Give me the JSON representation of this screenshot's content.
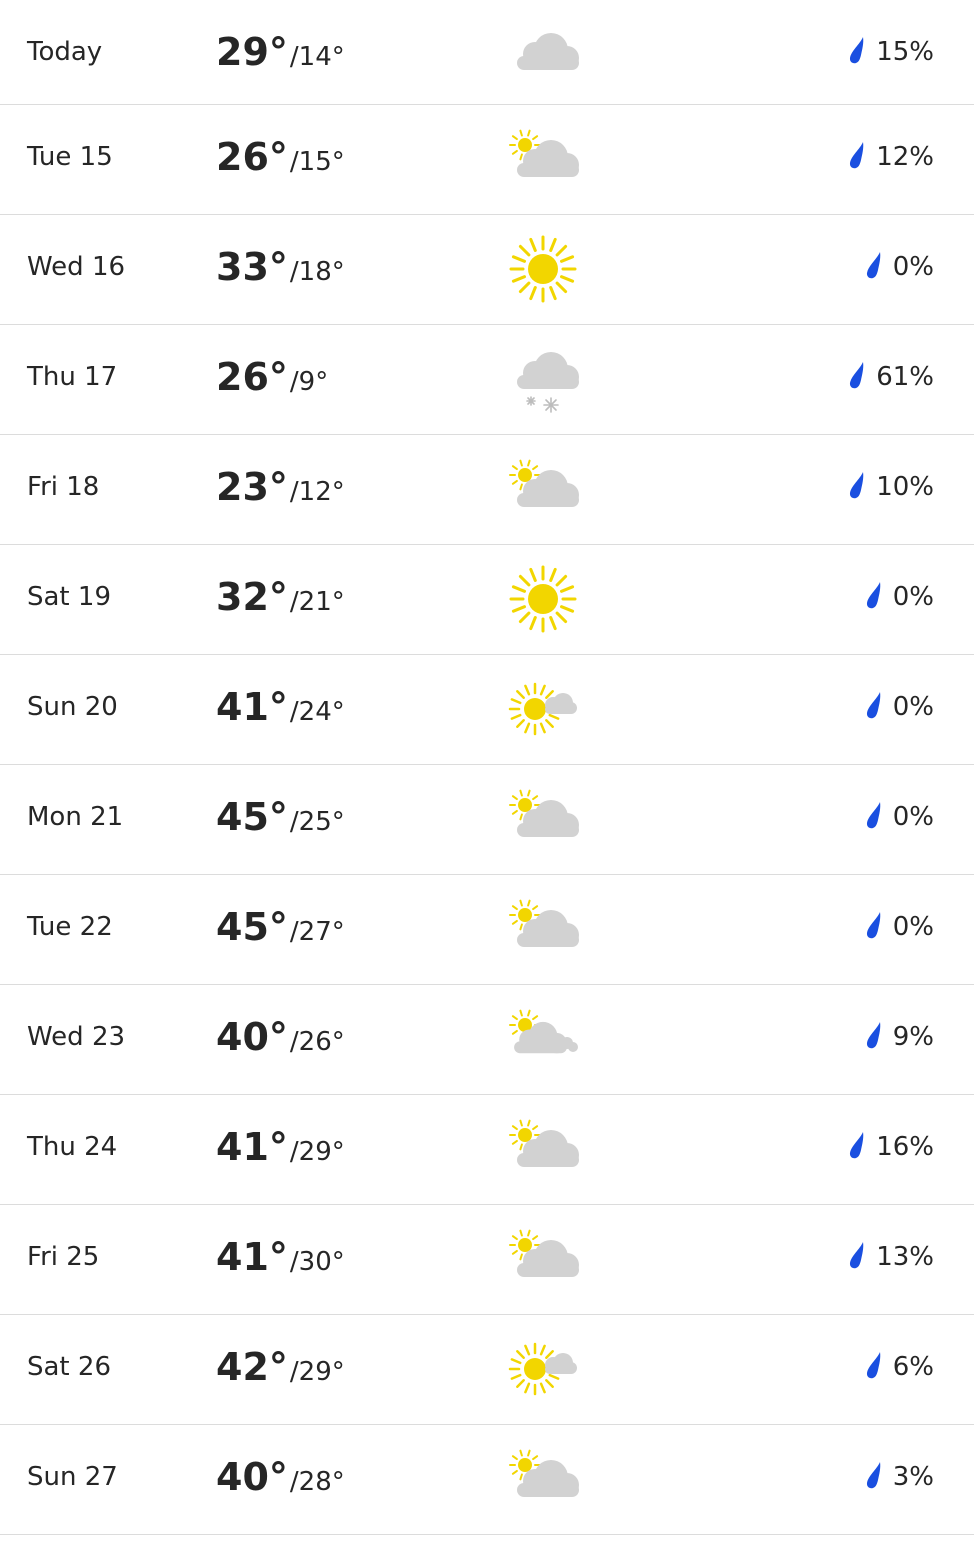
{
  "colors": {
    "sun": "#f2d600",
    "cloud": "#d2d2d2",
    "rain_drop": "#1a4fe0",
    "snow": "#bdbdbd",
    "divider": "#dcdcdc"
  },
  "days": [
    {
      "label": "Today",
      "high": "29°",
      "low": "14°",
      "icon": "cloudy-icon",
      "precip": "15%"
    },
    {
      "label": "Tue 15",
      "high": "26°",
      "low": "15°",
      "icon": "mostly-cloudy-icon",
      "precip": "12%"
    },
    {
      "label": "Wed 16",
      "high": "33°",
      "low": "18°",
      "icon": "sunny-icon",
      "precip": "0%"
    },
    {
      "label": "Thu 17",
      "high": "26°",
      "low": "9°",
      "icon": "snow-showers-icon",
      "precip": "61%"
    },
    {
      "label": "Fri 18",
      "high": "23°",
      "low": "12°",
      "icon": "mostly-cloudy-icon",
      "precip": "10%"
    },
    {
      "label": "Sat 19",
      "high": "32°",
      "low": "21°",
      "icon": "sunny-icon",
      "precip": "0%"
    },
    {
      "label": "Sun 20",
      "high": "41°",
      "low": "24°",
      "icon": "partly-sunny-icon",
      "precip": "0%"
    },
    {
      "label": "Mon 21",
      "high": "45°",
      "low": "25°",
      "icon": "mostly-cloudy-icon",
      "precip": "0%"
    },
    {
      "label": "Tue 22",
      "high": "45°",
      "low": "27°",
      "icon": "mostly-cloudy-icon",
      "precip": "0%"
    },
    {
      "label": "Wed 23",
      "high": "40°",
      "low": "26°",
      "icon": "mostly-cloudy-extra-icon",
      "precip": "9%"
    },
    {
      "label": "Thu 24",
      "high": "41°",
      "low": "29°",
      "icon": "mostly-cloudy-icon",
      "precip": "16%"
    },
    {
      "label": "Fri 25",
      "high": "41°",
      "low": "30°",
      "icon": "mostly-cloudy-icon",
      "precip": "13%"
    },
    {
      "label": "Sat 26",
      "high": "42°",
      "low": "29°",
      "icon": "partly-sunny-icon",
      "precip": "6%"
    },
    {
      "label": "Sun 27",
      "high": "40°",
      "low": "28°",
      "icon": "mostly-cloudy-icon",
      "precip": "3%"
    }
  ],
  "separator": "/"
}
